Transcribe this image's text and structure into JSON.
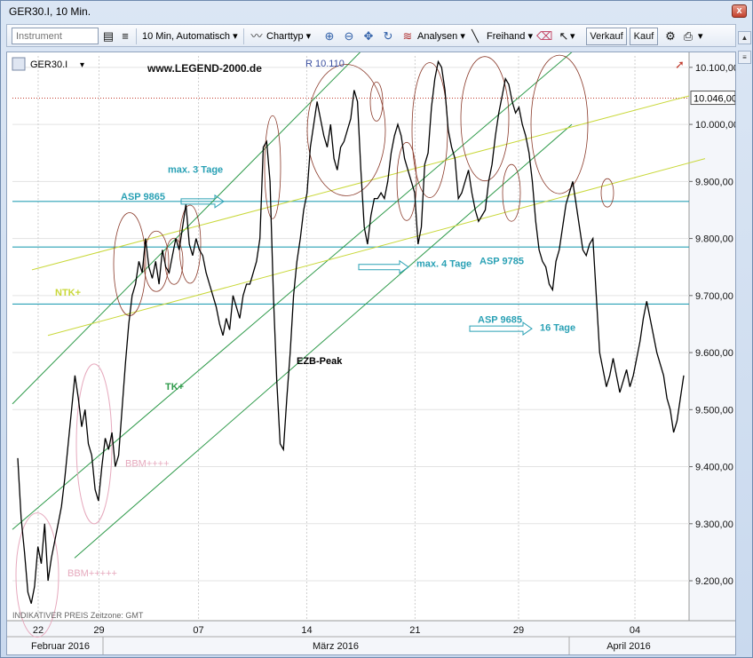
{
  "window": {
    "title": "GER30.I, 10 Min.",
    "close_glyph": "x"
  },
  "toolbar": {
    "instrument_placeholder": "Instrument",
    "timeframe": "10 Min, Automatisch",
    "charttype": "Charttyp",
    "analysen": "Analysen",
    "freihand": "Freihand",
    "verkauf": "Verkauf",
    "kauf": "Kauf"
  },
  "chart_header": {
    "symbol": "GER30.I",
    "website": "www.LEGEND-2000.de",
    "resistance_label": "R 10.110",
    "footer": "INDIKATIVER PREIS   Zeitzone: GMT"
  },
  "annotations": {
    "max3": "max. 3 Tage",
    "asp9865": "ASP 9865",
    "max4": "max. 4 Tage",
    "asp9785": "ASP 9785",
    "ntk": "NTK+",
    "asp9685": "ASP 9685",
    "tage16": "16 Tage",
    "tk": "TK+",
    "ezb": "EZB-Peak",
    "bbm1": "BBM++++",
    "bbm2": "BBM+++++"
  },
  "colors": {
    "price_line": "#000000",
    "teal_level": "#2aa1b5",
    "green_channel": "#2e9a4a",
    "yellow_trend": "#c9d83a",
    "ellipse": "#8a3a2a",
    "pink": "#e6a9bd",
    "annotation_text": "#2aa1b5",
    "title_blue": "#3a4fa0",
    "last_price_line": "#c0392b"
  },
  "chart_data": {
    "type": "line",
    "ylim": [
      9130,
      10120
    ],
    "y_ticks": [
      "10.100,00",
      "10.000,00",
      "9.900,00",
      "9.800,00",
      "9.700,00",
      "9.600,00",
      "9.500,00",
      "9.400,00",
      "9.300,00",
      "9.200,00"
    ],
    "y_tick_values": [
      10100,
      10000,
      9900,
      9800,
      9700,
      9600,
      9500,
      9400,
      9300,
      9200
    ],
    "last_price_label": "10.046,00",
    "last_price": 10046,
    "x_day_ticks": [
      "22",
      "29",
      "07",
      "14",
      "21",
      "29",
      "04"
    ],
    "x_month_labels": [
      "Februar 2016",
      "März 2016",
      "April 2016"
    ],
    "levels": [
      {
        "label": "ASP 9865",
        "value": 9865
      },
      {
        "label": "ASP 9785",
        "value": 9785
      },
      {
        "label": "ASP 9685",
        "value": 9685
      }
    ],
    "series": [
      {
        "values": [
          9415,
          9310,
          9250,
          9180,
          9160,
          9190,
          9260,
          9230,
          9300,
          9200,
          9240,
          9270,
          9300,
          9330,
          9380,
          9440,
          9500,
          9560,
          9520,
          9470,
          9500,
          9440,
          9420,
          9360,
          9340,
          9400,
          9450,
          9430,
          9460,
          9400,
          9420,
          9500,
          9580,
          9650,
          9700,
          9720,
          9760,
          9740,
          9800,
          9750,
          9730,
          9760,
          9720,
          9780,
          9750,
          9740,
          9770,
          9800,
          9780,
          9820,
          9860,
          9790,
          9770,
          9800,
          9780,
          9770,
          9740,
          9720,
          9700,
          9680,
          9650,
          9630,
          9660,
          9640,
          9700,
          9680,
          9660,
          9700,
          9720,
          9720,
          9740,
          9760,
          9800,
          9960,
          9970,
          9900,
          9700,
          9550,
          9440,
          9430,
          9520,
          9600,
          9700,
          9760,
          9800,
          9850,
          9880,
          9960,
          10000,
          10040,
          10010,
          9980,
          9960,
          10000,
          9940,
          9920,
          9960,
          9970,
          9990,
          10010,
          10060,
          10040,
          9920,
          9820,
          9790,
          9840,
          9870,
          9870,
          9880,
          9870,
          9900,
          9950,
          9980,
          10000,
          9980,
          9940,
          9920,
          9900,
          9880,
          9790,
          9820,
          9930,
          9950,
          10030,
          10080,
          10110,
          10100,
          10060,
          9990,
          9960,
          9940,
          9870,
          9880,
          9900,
          9920,
          9880,
          9850,
          9830,
          9840,
          9850,
          9900,
          9930,
          9980,
          10020,
          10050,
          10080,
          10070,
          10040,
          10020,
          10030,
          10000,
          9980,
          9950,
          9900,
          9830,
          9780,
          9760,
          9750,
          9720,
          9710,
          9760,
          9780,
          9820,
          9860,
          9880,
          9900,
          9860,
          9820,
          9780,
          9770,
          9790,
          9800,
          9700,
          9600,
          9570,
          9540,
          9560,
          9590,
          9560,
          9530,
          9550,
          9570,
          9540,
          9560,
          9590,
          9620,
          9660,
          9690,
          9660,
          9630,
          9600,
          9580,
          9560,
          9520,
          9500,
          9460,
          9480,
          9520,
          9560
        ]
      }
    ]
  }
}
